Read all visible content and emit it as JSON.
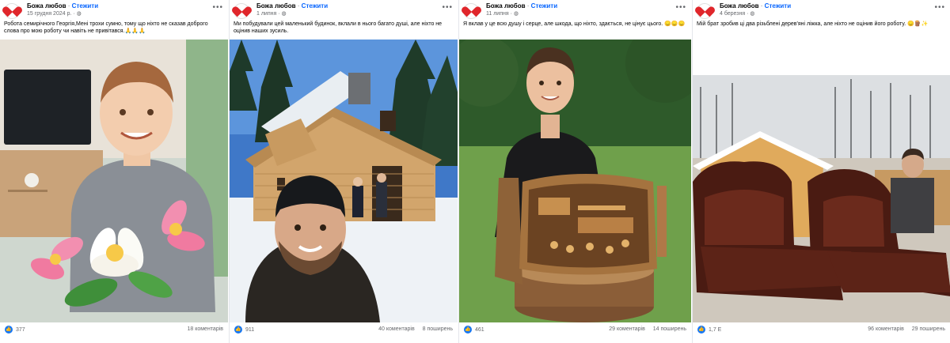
{
  "posts": [
    {
      "author": "Божа любов",
      "follow": "Стежити",
      "date": "15 грудня 2024 р.",
      "caption": "Робота семирічного Георгія,Мені трохи сумно, тому що ніхто не сказав доброго слова про мою роботу чи навіть не привітався.🙏🙏🙏",
      "reactions": "377",
      "comments": "18 коментарів",
      "shares": ""
    },
    {
      "author": "Божа любов",
      "follow": "Стежити",
      "date": "1 липня",
      "caption": "Ми побудували цей маленький будинок, вклали в нього багато душі, але ніхто не оцінив наших зусиль.",
      "reactions": "911",
      "comments": "40 коментарів",
      "shares": "8 поширень"
    },
    {
      "author": "Божа любов",
      "follow": "Стежити",
      "date": "11 липня",
      "caption": "Я вклав у це всю душу і серце, але шкода, що ніхто, здається, не цінує цього. 😞😞😞",
      "reactions": "461",
      "comments": "29 коментарів",
      "shares": "14 поширень"
    },
    {
      "author": "Божа любов",
      "follow": "Стежити",
      "date": "4 березня",
      "caption": "Мій брат зробив ці два різьблені дерев'яні ліжка, але ніхто не оцінив його роботу. 😞🪵✨",
      "reactions": "1,7 Е",
      "comments": "96 коментарів",
      "shares": "29 поширень"
    }
  ],
  "ui": {
    "separator": "·",
    "globe_icon": "globe-icon",
    "more_icon": "more-options-icon",
    "like_icon": "like-icon",
    "heart_logo": "heart-logo-icon"
  },
  "colors": {
    "follow": "#0866ff",
    "like": "#1877f2",
    "muted": "#65676b",
    "logo": "#e0262b"
  }
}
